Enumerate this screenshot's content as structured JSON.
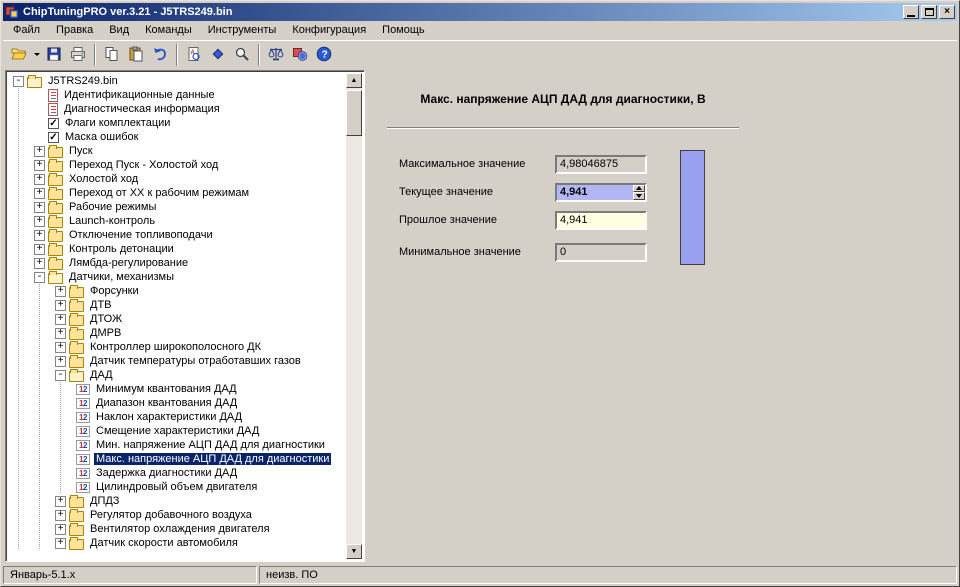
{
  "window": {
    "title": "ChipTuningPRO ver.3.21 - J5TRS249.bin"
  },
  "menu": {
    "items": [
      "Файл",
      "Правка",
      "Вид",
      "Команды",
      "Инструменты",
      "Конфигурация",
      "Помощь"
    ]
  },
  "toolbar": {
    "buttons": [
      {
        "name": "open-button",
        "icon": "open-folder-icon"
      },
      {
        "name": "open-dropdown-button",
        "icon": "caret-down-icon"
      },
      {
        "name": "save-button",
        "icon": "floppy-icon"
      },
      {
        "name": "print-button",
        "icon": "printer-icon"
      },
      {
        "sep": true
      },
      {
        "name": "copy-button",
        "icon": "copy-icon"
      },
      {
        "name": "paste-button",
        "icon": "paste-icon"
      },
      {
        "name": "undo-button",
        "icon": "undo-icon"
      },
      {
        "sep": true
      },
      {
        "name": "checksum-button",
        "icon": "document-search-icon"
      },
      {
        "name": "compare-button",
        "icon": "diamond-icon"
      },
      {
        "name": "zoom-button",
        "icon": "magnifier-icon"
      },
      {
        "sep": true
      },
      {
        "name": "measure-button",
        "icon": "scales-icon"
      },
      {
        "name": "config-button",
        "icon": "config-icon"
      },
      {
        "name": "help-button",
        "icon": "help-icon"
      }
    ]
  },
  "tree": {
    "items": [
      {
        "depth": 0,
        "type": "root",
        "expander": "minus",
        "label": "J5TRS249.bin"
      },
      {
        "depth": 1,
        "type": "document",
        "expander": null,
        "label": "Идентификационные данные"
      },
      {
        "depth": 1,
        "type": "document",
        "expander": null,
        "label": "Диагностическая информация"
      },
      {
        "depth": 1,
        "type": "checkbox",
        "expander": null,
        "label": "Флаги комплектации"
      },
      {
        "depth": 1,
        "type": "checkbox",
        "expander": null,
        "label": "Маска ошибок"
      },
      {
        "depth": 1,
        "type": "folder",
        "expander": "plus",
        "label": "Пуск"
      },
      {
        "depth": 1,
        "type": "folder",
        "expander": "plus",
        "label": "Переход Пуск - Холостой ход"
      },
      {
        "depth": 1,
        "type": "folder",
        "expander": "plus",
        "label": "Холостой ход"
      },
      {
        "depth": 1,
        "type": "folder",
        "expander": "plus",
        "label": "Переход от ХХ к рабочим режимам"
      },
      {
        "depth": 1,
        "type": "folder",
        "expander": "plus",
        "label": "Рабочие режимы"
      },
      {
        "depth": 1,
        "type": "folder",
        "expander": "plus",
        "label": "Launch-контроль"
      },
      {
        "depth": 1,
        "type": "folder",
        "expander": "plus",
        "label": "Отключение топливоподачи"
      },
      {
        "depth": 1,
        "type": "folder",
        "expander": "plus",
        "label": "Контроль детонации"
      },
      {
        "depth": 1,
        "type": "folder",
        "expander": "plus",
        "label": "Лямбда-регулирование"
      },
      {
        "depth": 1,
        "type": "folder-open",
        "expander": "minus",
        "label": "Датчики, механизмы"
      },
      {
        "depth": 2,
        "type": "folder",
        "expander": "plus",
        "label": "Форсунки"
      },
      {
        "depth": 2,
        "type": "folder",
        "expander": "plus",
        "label": "ДТВ"
      },
      {
        "depth": 2,
        "type": "folder",
        "expander": "plus",
        "label": "ДТОЖ"
      },
      {
        "depth": 2,
        "type": "folder",
        "expander": "plus",
        "label": "ДМРВ"
      },
      {
        "depth": 2,
        "type": "folder",
        "expander": "plus",
        "label": "Контроллер широкополосного ДК"
      },
      {
        "depth": 2,
        "type": "folder",
        "expander": "plus",
        "label": "Датчик температуры отработавших газов"
      },
      {
        "depth": 2,
        "type": "folder-open",
        "expander": "minus",
        "label": "ДАД"
      },
      {
        "depth": 3,
        "type": "param",
        "expander": null,
        "label": "Минимум квантования ДАД"
      },
      {
        "depth": 3,
        "type": "param",
        "expander": null,
        "label": "Диапазон квантования ДАД"
      },
      {
        "depth": 3,
        "type": "param",
        "expander": null,
        "label": "Наклон характеристики ДАД"
      },
      {
        "depth": 3,
        "type": "param",
        "expander": null,
        "label": "Смещение характеристики ДАД"
      },
      {
        "depth": 3,
        "type": "param",
        "expander": null,
        "label": "Мин. напряжение АЦП ДАД для диагностики"
      },
      {
        "depth": 3,
        "type": "param",
        "expander": null,
        "label": "Макс. напряжение АЦП ДАД для диагностики",
        "selected": true
      },
      {
        "depth": 3,
        "type": "param",
        "expander": null,
        "label": "Задержка диагностики ДАД"
      },
      {
        "depth": 3,
        "type": "param",
        "expander": null,
        "label": "Цилиндровый объем двигателя"
      },
      {
        "depth": 2,
        "type": "folder",
        "expander": "plus",
        "label": "ДПДЗ"
      },
      {
        "depth": 2,
        "type": "folder",
        "expander": "plus",
        "label": "Регулятор добавочного воздуха"
      },
      {
        "depth": 2,
        "type": "folder",
        "expander": "plus",
        "label": "Вентилятор охлаждения двигателя"
      },
      {
        "depth": 2,
        "type": "folder",
        "expander": "plus",
        "label": "Датчик скорости автомобиля"
      }
    ]
  },
  "editor": {
    "title": "Макс. напряжение АЦП ДАД для диагностики, В",
    "fields": [
      {
        "name": "max-value",
        "label": "Максимальное значение",
        "value": "4,98046875",
        "kind": "readonly"
      },
      {
        "name": "current-value",
        "label": "Текущее значение",
        "value": "4,941",
        "kind": "current"
      },
      {
        "name": "previous-value",
        "label": "Прошлое значение",
        "value": "4,941",
        "kind": "previous"
      },
      {
        "name": "min-value",
        "label": "Минимальное значение",
        "value": "0",
        "kind": "readonly"
      }
    ],
    "gauge_color": "#9aa0ef"
  },
  "statusbar": {
    "left": "Январь-5.1.х",
    "right": "неизв. ПО"
  }
}
